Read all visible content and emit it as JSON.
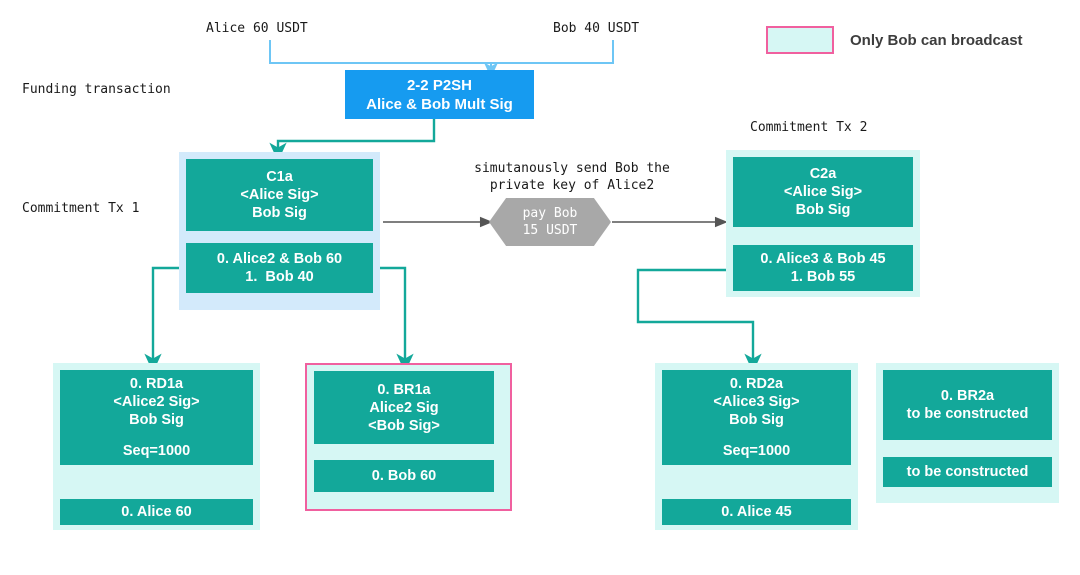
{
  "colors": {
    "teal": "#13a89a",
    "light_teal": "#d6f7f4",
    "light_blue": "#d3eafb",
    "blue": "#169bf0",
    "pink": "#f0609f",
    "gray": "#a8a8a8",
    "arrow_gray": "#555555",
    "connector_teal": "#13a89a",
    "connector_blue": "#6ec6f5"
  },
  "annotations": {
    "alice_input": "Alice 60 USDT",
    "bob_input": "Bob 40 USDT",
    "funding_transaction": "Funding transaction",
    "commitment_tx_1": "Commitment Tx 1",
    "commitment_tx_2": "Commitment Tx 2",
    "simultaneous_note_line1": "simutanously send Bob the",
    "simultaneous_note_line2": "private key of Alice2"
  },
  "legend": {
    "label": "Only Bob can broadcast"
  },
  "funding_box": {
    "line1": "2-2 P2SH",
    "line2": "Alice & Bob Mult Sig"
  },
  "payment_hex": {
    "line1": "pay Bob",
    "line2": "15 USDT"
  },
  "c1a": {
    "head": [
      "C1a",
      "<Alice Sig>",
      "Bob Sig"
    ],
    "outputs": [
      "0. Alice2 & Bob 60",
      "1.  Bob 40"
    ]
  },
  "c2a": {
    "head": [
      "C2a",
      "<Alice Sig>",
      "Bob Sig"
    ],
    "outputs": [
      "0. Alice3 & Bob 45",
      "1. Bob 55"
    ]
  },
  "rd1a": {
    "head": [
      "0. RD1a",
      "<Alice2 Sig>",
      "Bob Sig"
    ],
    "seq": "Seq=1000",
    "outputs": [
      "0. Alice 60"
    ]
  },
  "br1a": {
    "head": [
      "0. BR1a",
      "Alice2 Sig",
      "<Bob Sig>"
    ],
    "outputs": [
      "0. Bob 60"
    ]
  },
  "rd2a": {
    "head": [
      "0. RD2a",
      "<Alice3 Sig>",
      "Bob Sig"
    ],
    "seq": "Seq=1000",
    "outputs": [
      "0. Alice 45"
    ]
  },
  "br2a": {
    "head": [
      "0. BR2a",
      "to be constructed"
    ],
    "outputs": [
      "to be constructed"
    ]
  }
}
